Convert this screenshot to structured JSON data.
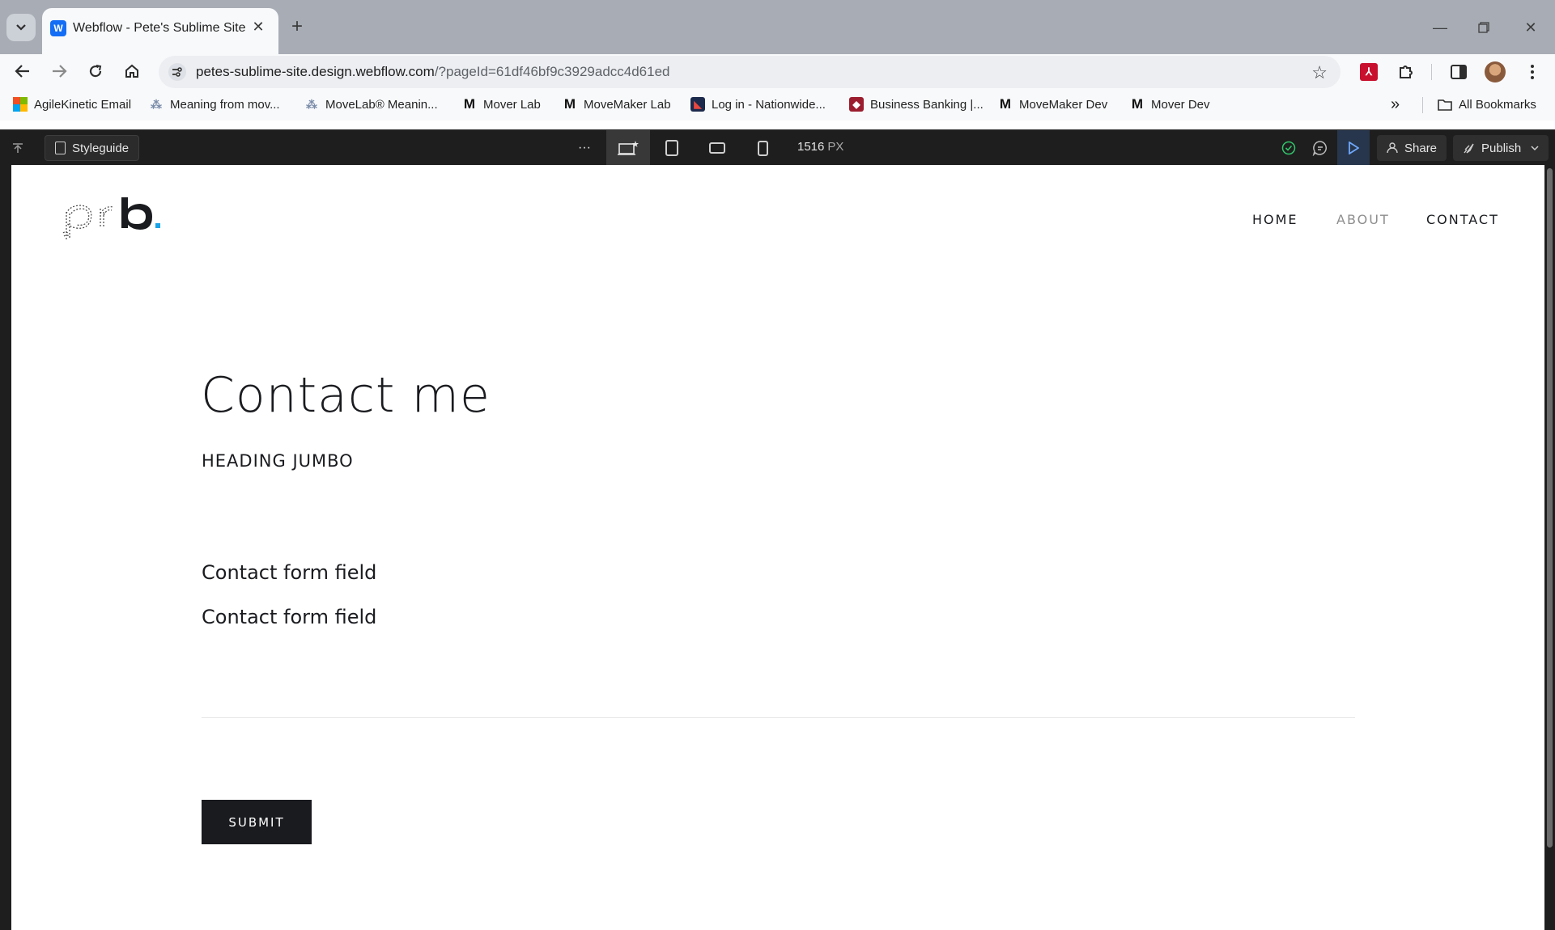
{
  "browser": {
    "tab_title": "Webflow - Pete's Sublime Site",
    "tab_favicon": "W",
    "url_host": "petes-sublime-site.design.webflow.com",
    "url_path": "/?pageId=61df46bf9c3929adcc4d61ed",
    "bookmarks": [
      {
        "label": "AgileKinetic Email",
        "icon": "microsoft-icon"
      },
      {
        "label": "Meaning from mov...",
        "icon": "movelab-icon"
      },
      {
        "label": "MoveLab® Meanin...",
        "icon": "movelab-icon"
      },
      {
        "label": "Mover Lab",
        "icon": "m-icon"
      },
      {
        "label": "MoveMaker Lab",
        "icon": "m-icon"
      },
      {
        "label": "Log in - Nationwide...",
        "icon": "nationwide-icon"
      },
      {
        "label": "Business Banking |...",
        "icon": "bank-icon"
      },
      {
        "label": "MoveMaker Dev",
        "icon": "m-icon"
      },
      {
        "label": "Mover Dev",
        "icon": "m-icon"
      }
    ],
    "all_bookmarks_label": "All Bookmarks"
  },
  "designer": {
    "page_label": "Styleguide",
    "more_label": "···",
    "width_value": "1516",
    "width_unit": "PX",
    "share_label": "Share",
    "publish_label": "Publish"
  },
  "site": {
    "logo_text": "prb",
    "logo_accent": "#1aa3e6",
    "nav": [
      "HOME",
      "ABOUT",
      "CONTACT"
    ],
    "heading": "Contact me",
    "subheading": "HEADING JUMBO",
    "field_1": "Contact form field",
    "field_2": "Contact form field",
    "submit_label": "SUBMIT"
  }
}
